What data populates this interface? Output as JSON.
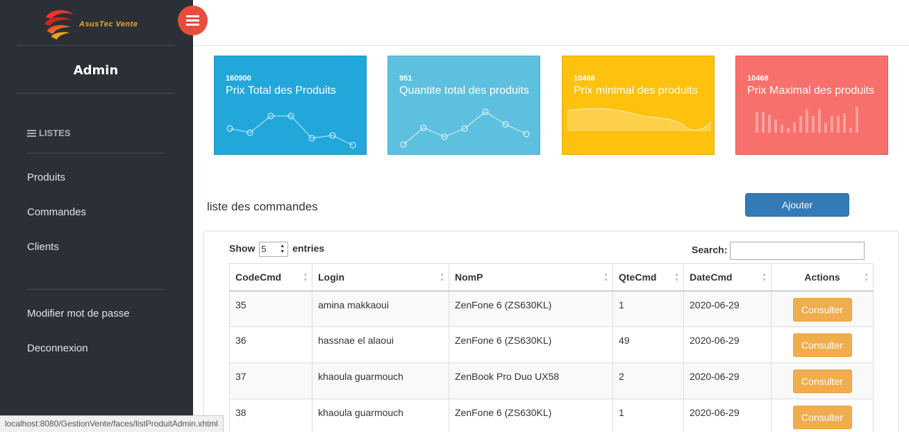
{
  "brand": {
    "name": "AsusTec Vente"
  },
  "sidebar": {
    "user": "Admin",
    "section_title": "LISTES",
    "items": [
      {
        "label": "Produits"
      },
      {
        "label": "Commandes"
      },
      {
        "label": "Clients"
      }
    ],
    "account_items": [
      {
        "label": "Modifier mot de passe"
      },
      {
        "label": "Deconnexion"
      }
    ]
  },
  "stats": [
    {
      "value": "160900",
      "label": "Prix Total des Produits",
      "color": "#22a7db",
      "graph": "line"
    },
    {
      "value": "951",
      "label": "Quantite total des produits",
      "color": "#5dc0de",
      "graph": "line"
    },
    {
      "value": "10468",
      "label": "Prix minimal des produits",
      "color": "#fdc10e",
      "graph": "area"
    },
    {
      "value": "10468",
      "label": "Prix Maximal des produits",
      "color": "#f8706b",
      "graph": "bar"
    }
  ],
  "list": {
    "title": "liste des commandes",
    "add_label": "Ajouter",
    "show_label": "Show",
    "show_value": "5",
    "entries_label": "entries",
    "search_label": "Search:",
    "columns": [
      "CodeCmd",
      "Login",
      "NomP",
      "QteCmd",
      "DateCmd",
      "Actions"
    ],
    "rows": [
      {
        "code": "35",
        "login": "amina makkaoui",
        "product": "ZenFone 6 (ZS630KL)",
        "qty": "1",
        "date": "2020-06-29",
        "action": "Consulter"
      },
      {
        "code": "36",
        "login": "hassnae el alaoui",
        "product": "ZenFone 6 (ZS630KL)",
        "qty": "49",
        "date": "2020-06-29",
        "action": "Consulter"
      },
      {
        "code": "37",
        "login": "khaoula guarmouch",
        "product": "ZenBook Pro Duo UX58",
        "qty": "2",
        "date": "2020-06-29",
        "action": "Consulter"
      },
      {
        "code": "38",
        "login": "khaoula guarmouch",
        "product": "ZenFone 6 (ZS630KL)",
        "qty": "1",
        "date": "2020-06-29",
        "action": "Consulter"
      }
    ]
  },
  "statusbar": {
    "url": "localhost:8080/GestionVente/faces/listProduitAdmin.xhtml"
  },
  "colors": {
    "sidebar": "#2b3036",
    "primary": "#337ab7",
    "warning": "#f0ad4e",
    "menu_button": "#e84c3d"
  }
}
